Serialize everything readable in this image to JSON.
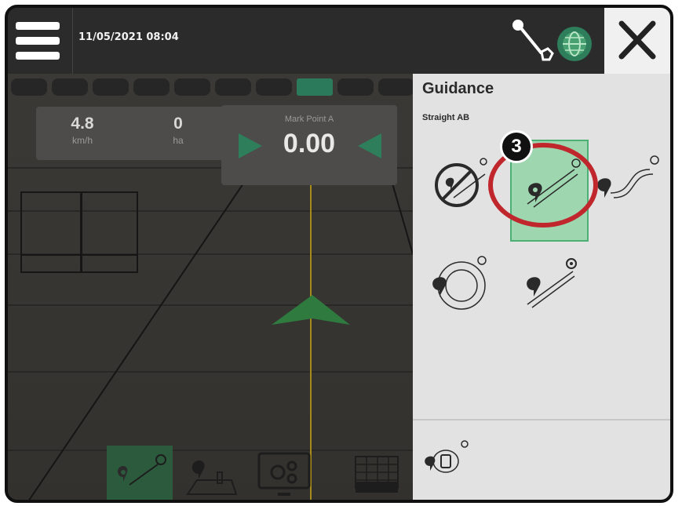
{
  "status_bar": {
    "datetime": "11/05/2021 08:04",
    "menu_icon": "hamburger-menu-icon",
    "connection_icon": "line-connector-icon",
    "gnss_icon": "globe-satellite-icon",
    "close_icon": "close-x-icon"
  },
  "field": {
    "speed": {
      "value": "4.8",
      "unit": "km/h"
    },
    "area": {
      "value": "0",
      "unit": "ha"
    },
    "mark_point": {
      "label": "Mark Point A",
      "value": "0.00"
    },
    "lightbar": {
      "active_index": 7
    }
  },
  "bottom_toolbar": [
    {
      "icon": "guidance-line-icon",
      "active": true
    },
    {
      "icon": "field-boundary-icon",
      "active": false
    },
    {
      "icon": "machine-settings-icon",
      "active": false
    },
    {
      "icon": "map-layers-icon",
      "active": false
    }
  ],
  "guidance_panel": {
    "title": "Guidance",
    "subtitle": "Straight AB",
    "modes": [
      {
        "name": "no-guidance",
        "icon": "no-guidance-icon",
        "selected": false
      },
      {
        "name": "straight-ab",
        "icon": "straight-ab-icon",
        "selected": true
      },
      {
        "name": "curved-ab",
        "icon": "curved-ab-icon",
        "selected": false
      },
      {
        "name": "circle-pivot",
        "icon": "circle-pivot-icon",
        "selected": false
      },
      {
        "name": "last-pass",
        "icon": "last-pass-icon",
        "selected": false
      }
    ],
    "delete_icon": "delete-guideline-icon"
  },
  "callout": {
    "number": "3",
    "color": "#c0272d"
  },
  "colors": {
    "accent_green": "#2e7d5b",
    "selected_green": "#9ed6b0",
    "panel_bg": "#e2e2e2"
  }
}
